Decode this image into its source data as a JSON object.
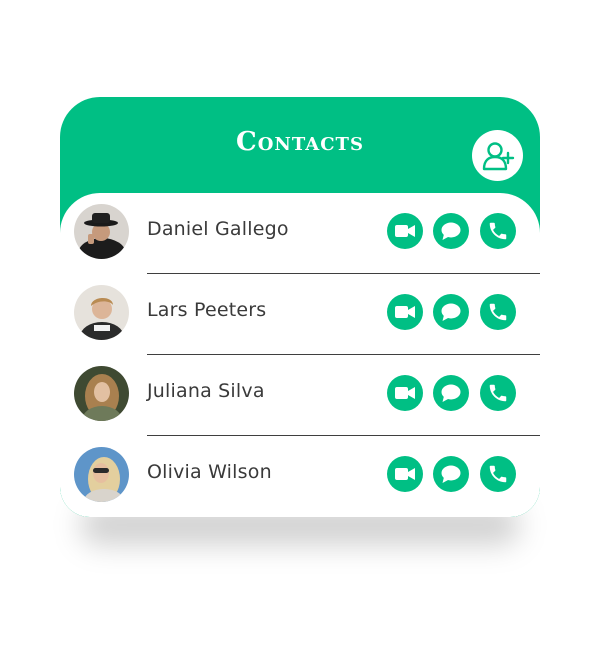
{
  "header": {
    "title": "Contacts",
    "add_icon": "add-user-icon"
  },
  "colors": {
    "accent": "#00bf84",
    "card_bg": "#ffffff",
    "text": "#3a3a3a",
    "divider": "#3f3f3f"
  },
  "contacts": [
    {
      "name": "Daniel Gallego",
      "avatar": "avatar-man-hat"
    },
    {
      "name": "Lars Peeters",
      "avatar": "avatar-young-man"
    },
    {
      "name": "Juliana Silva",
      "avatar": "avatar-woman-curly"
    },
    {
      "name": "Olivia Wilson",
      "avatar": "avatar-woman-sunglasses"
    }
  ],
  "actions": {
    "video_icon": "video-camera-icon",
    "chat_icon": "chat-bubble-icon",
    "call_icon": "phone-icon"
  }
}
